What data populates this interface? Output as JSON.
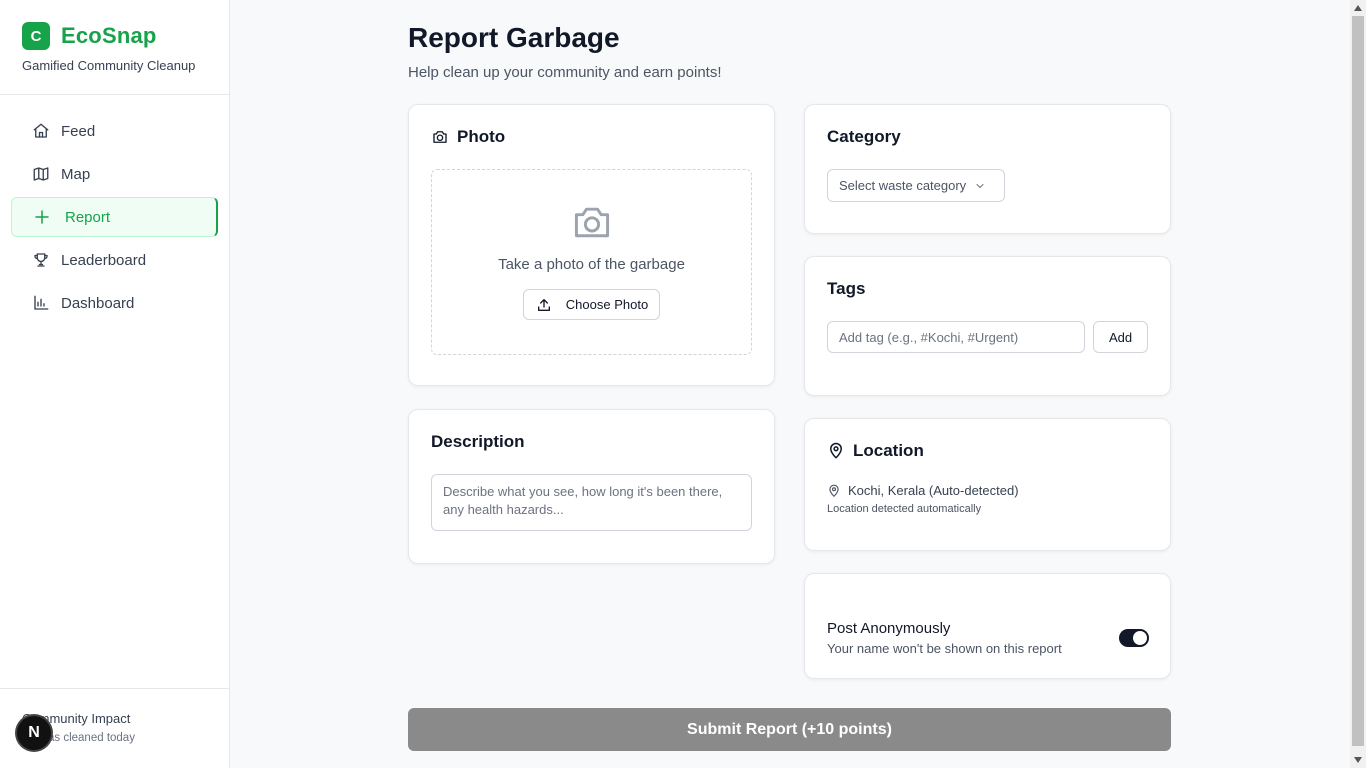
{
  "brand": {
    "logo_letter": "C",
    "name": "EcoSnap",
    "tagline": "Gamified Community Cleanup"
  },
  "sidebar": {
    "items": [
      {
        "label": "Feed",
        "icon": "home-icon"
      },
      {
        "label": "Map",
        "icon": "map-icon"
      },
      {
        "label": "Report",
        "icon": "plus-icon",
        "active": true
      },
      {
        "label": "Leaderboard",
        "icon": "trophy-icon"
      },
      {
        "label": "Dashboard",
        "icon": "bar-chart-icon"
      }
    ],
    "impact_title": "Community Impact",
    "impact_sub": "as cleaned today",
    "badge_letter": "N"
  },
  "page": {
    "title": "Report Garbage",
    "subtitle": "Help clean up your community and earn points!"
  },
  "photo": {
    "title": "Photo",
    "prompt": "Take a photo of the garbage",
    "choose_label": "Choose Photo"
  },
  "description": {
    "title": "Description",
    "placeholder": "Describe what you see, how long it's been there, any health hazards..."
  },
  "category": {
    "title": "Category",
    "placeholder": "Select waste category"
  },
  "tags": {
    "title": "Tags",
    "placeholder": "Add tag (e.g., #Kochi, #Urgent)",
    "add_label": "Add"
  },
  "location": {
    "title": "Location",
    "value": "Kochi, Kerala (Auto-detected)",
    "note": "Location detected automatically"
  },
  "anonymous": {
    "title": "Post Anonymously",
    "subtitle": "Your name won't be shown on this report",
    "enabled": true
  },
  "submit": {
    "label": "Submit Report (+10 points)"
  },
  "colors": {
    "accent": "#16a34a",
    "submit_bg": "#8a8a8a",
    "toggle_on": "#111827"
  }
}
